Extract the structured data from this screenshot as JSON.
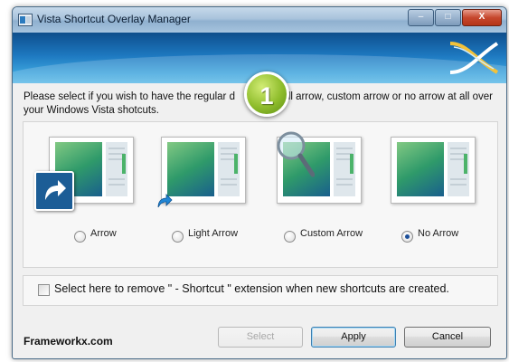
{
  "window": {
    "title": "Vista Shortcut Overlay Manager",
    "controls": {
      "minimize": "–",
      "maximize": "□",
      "close": "X"
    }
  },
  "instruction": "Please select if you wish to have the regular d",
  "instruction_rest": "all arrow, custom arrow or no arrow at all over your Windows Vista shotcuts.",
  "callout_number": "1",
  "options": [
    {
      "label": "Arrow",
      "selected": false,
      "overlay": "large-shortcut-arrow-icon"
    },
    {
      "label": "Light Arrow",
      "selected": false,
      "overlay": "light-shortcut-arrow-icon"
    },
    {
      "label": "Custom Arrow",
      "selected": false,
      "overlay": "magnifier-icon"
    },
    {
      "label": "No Arrow",
      "selected": true,
      "overlay": "none"
    }
  ],
  "remove_suffix_checkbox": {
    "label": "Select here to remove \" - Shortcut \" extension when new shortcuts are created.",
    "checked": false
  },
  "footer": {
    "brand": "Frameworkx.com",
    "buttons": {
      "select": "Select",
      "apply": "Apply",
      "cancel": "Cancel"
    }
  },
  "colors": {
    "banner": "#1d78c0",
    "callout": "#8fbd2c",
    "selected_radio": "#1c4f9a"
  }
}
